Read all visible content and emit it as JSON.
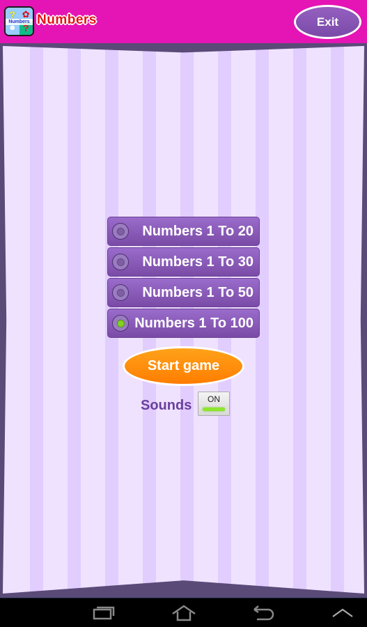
{
  "header": {
    "app_icon_label": "Numbers",
    "title": "Numbers",
    "exit_label": "Exit"
  },
  "options": [
    {
      "label": "Numbers 1 To 20",
      "selected": false
    },
    {
      "label": "Numbers 1 To 30",
      "selected": false
    },
    {
      "label": "Numbers 1 To 50",
      "selected": false
    },
    {
      "label": "Numbers 1 To 100",
      "selected": true
    }
  ],
  "start_label": "Start game",
  "sounds": {
    "label": "Sounds",
    "toggle_state": "ON"
  },
  "navbar": {
    "icons": [
      "recent-apps-icon",
      "home-icon",
      "back-icon",
      "chevron-up-icon"
    ]
  },
  "colors": {
    "header": "#e514b5",
    "option": "#8a5cba",
    "start": "#ff8c0a",
    "selected_radio": "#7fd321"
  }
}
